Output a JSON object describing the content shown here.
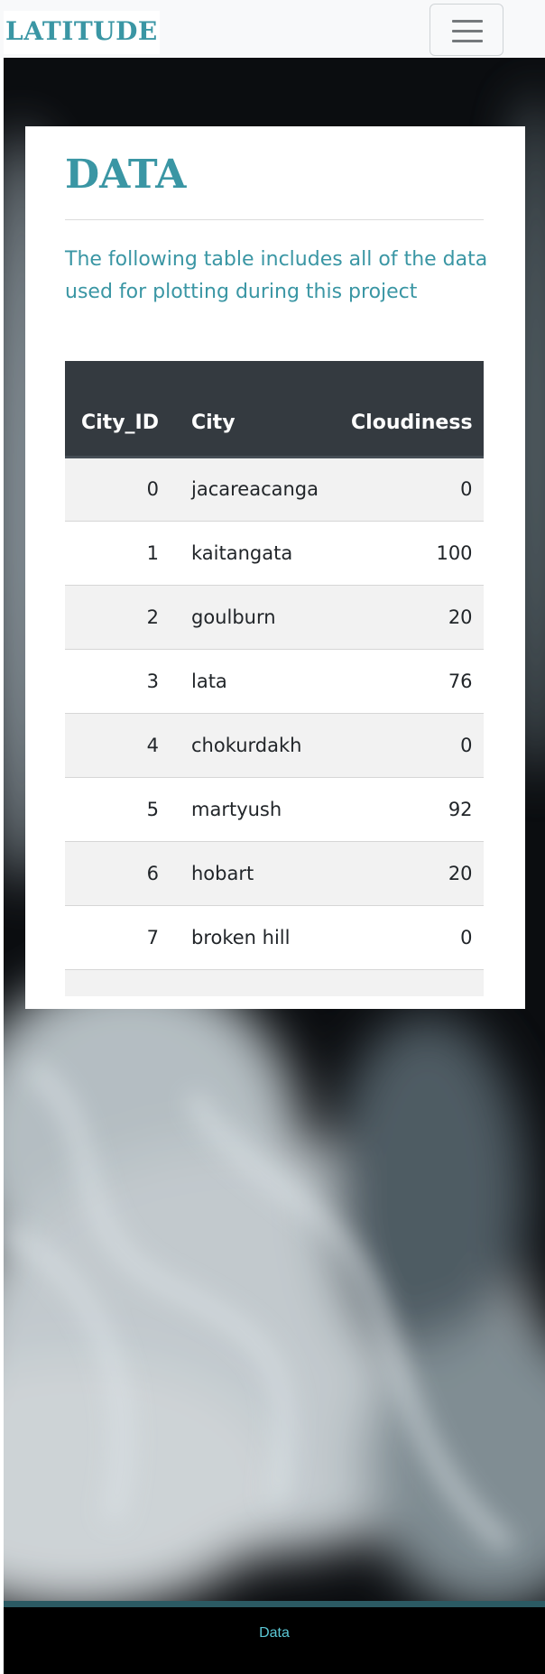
{
  "navbar": {
    "brand": "LATITUDE",
    "toggler_icon": "hamburger-menu-icon"
  },
  "content": {
    "title": "DATA",
    "description": "The following table includes all of the data used for plotting during this project"
  },
  "table": {
    "columns": [
      "City_ID",
      "City",
      "Cloudiness"
    ],
    "rows": [
      {
        "id": "0",
        "city": "jacareacanga",
        "cloudiness": "0"
      },
      {
        "id": "1",
        "city": "kaitangata",
        "cloudiness": "100"
      },
      {
        "id": "2",
        "city": "goulburn",
        "cloudiness": "20"
      },
      {
        "id": "3",
        "city": "lata",
        "cloudiness": "76"
      },
      {
        "id": "4",
        "city": "chokurdakh",
        "cloudiness": "0"
      },
      {
        "id": "5",
        "city": "martyush",
        "cloudiness": "92"
      },
      {
        "id": "6",
        "city": "hobart",
        "cloudiness": "20"
      },
      {
        "id": "7",
        "city": "broken hill",
        "cloudiness": "0"
      }
    ]
  },
  "footer": {
    "link": "Data"
  },
  "colors": {
    "accent": "#3a96a4",
    "table_header": "#343a40",
    "footer_link": "#5bc8d6"
  }
}
